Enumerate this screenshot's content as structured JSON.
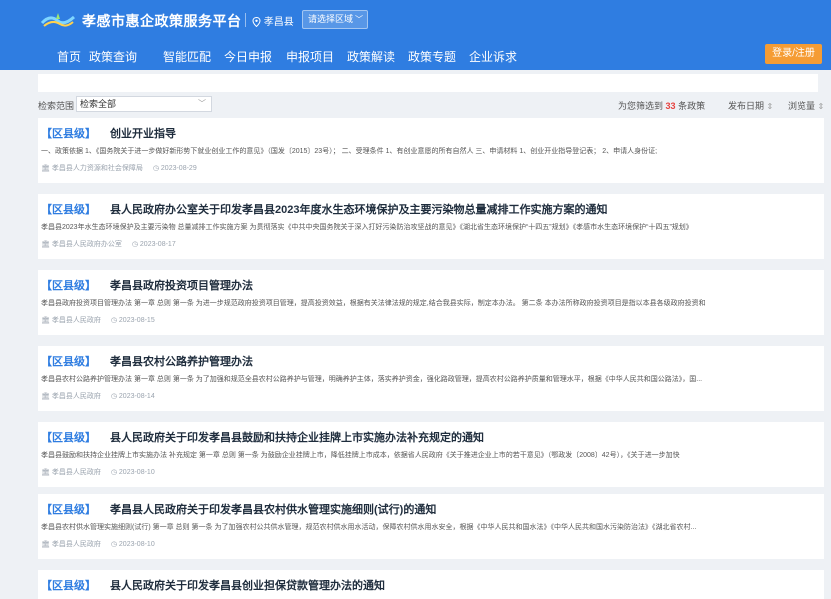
{
  "header": {
    "site_title": "孝感市惠企政策服务平台",
    "location": "孝昌县",
    "region_select": "请选择区域",
    "login_label": "登录/注册",
    "colors": {
      "bar": "#2f7de1",
      "login": "#f59c34"
    }
  },
  "nav": [
    {
      "label": "首页"
    },
    {
      "label": "政策查询"
    },
    {
      "label": "智能匹配"
    },
    {
      "label": "今日申报"
    },
    {
      "label": "申报项目"
    },
    {
      "label": "政策解读"
    },
    {
      "label": "政策专题"
    },
    {
      "label": "企业诉求"
    }
  ],
  "filter": {
    "label": "检索范围",
    "select_value": "检索全部",
    "result_prefix": "为您筛选到",
    "result_count": "33",
    "result_suffix": "条政策",
    "sort_date": "发布日期",
    "sort_views": "浏览量"
  },
  "policies": [
    {
      "level": "【区县级】",
      "title": "创业开业指导",
      "summary": "一、政策依据 1、《国务院关于进一步做好新形势下就业创业工作的意见》（国发〔2015〕23号）； 二、受理条件 1、有创业意愿的所有自然人 三、申请材料 1、创业开业指导登记表； 2、申请人身份证;",
      "department": "孝昌县人力资源和社会保障局",
      "date": "2023-08-29"
    },
    {
      "level": "【区县级】",
      "title": "县人民政府办公室关于印发孝昌县2023年度水生态环境保护及主要污染物总量减排工作实施方案的通知",
      "summary": "孝昌县2023年水生态环境保护及主要污染物 总量减排工作实施方案 为贯彻落实《中共中央国务院关于深入打好污染防治攻坚战的意见》《湖北省生态环境保护“十四五”规划》《孝感市水生态环境保护“十四五”规划》",
      "department": "孝昌县人民政府办公室",
      "date": "2023-08-17"
    },
    {
      "level": "【区县级】",
      "title": "孝昌县政府投资项目管理办法",
      "summary": "孝昌县政府投资项目管理办法 第一章 总则 第一条 为进一步规范政府投资项目管理，提高投资效益，根据有关法律法规的规定,结合我县实际，制定本办法。 第二条 本办法所称政府投资项目是指以本县各级政府投资和",
      "department": "孝昌县人民政府",
      "date": "2023-08-15"
    },
    {
      "level": "【区县级】",
      "title": "孝昌县农村公路养护管理办法",
      "summary": "孝昌县农村公路养护管理办法 第一章 总则 第一条 为了加强和规范全县农村公路养护与管理，明确养护主体，落实养护资金，强化路政管理，提高农村公路养护质量和管理水平，根据《中华人民共和国公路法》，国...",
      "department": "孝昌县人民政府",
      "date": "2023-08-14"
    },
    {
      "level": "【区县级】",
      "title": "县人民政府关于印发孝昌县鼓励和扶持企业挂牌上市实施办法补充规定的通知",
      "summary": "孝昌县鼓励和扶持企业挂牌上市实施办法 补充规定 第一章 总则 第一条 为鼓励企业挂牌上市，降低挂牌上市成本，依据省人民政府《关于推进企业上市的若干意见》（鄂政发〔2008〕42号），《关于进一步加快",
      "department": "孝昌县人民政府",
      "date": "2023-08-10"
    },
    {
      "level": "【区县级】",
      "title": "孝昌县人民政府关于印发孝昌县农村供水管理实施细则(试行)的通知",
      "summary": "孝昌县农村供水管理实施细则(试行) 第一章 总则 第一条 为了加强农村公共供水管理，规范农村供水用水活动，保障农村供水用水安全，根据《中华人民共和国水法》《中华人民共和国水污染防治法》《湖北省农村...",
      "department": "孝昌县人民政府",
      "date": "2023-08-10"
    },
    {
      "level": "【区县级】",
      "title": "县人民政府关于印发孝昌县创业担保贷款管理办法的通知",
      "summary": "",
      "department": "",
      "date": ""
    }
  ]
}
